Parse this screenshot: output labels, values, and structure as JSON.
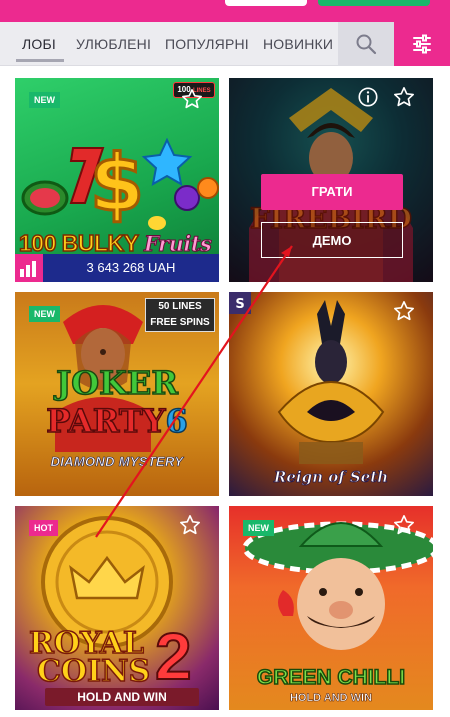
{
  "nav": {
    "tabs": [
      "ЛОБІ",
      "УЛЮБЛЕНІ",
      "ПОПУЛЯРНІ",
      "НОВИНКИ"
    ],
    "active_tab": "ЛОБІ",
    "search_icon": "search-icon",
    "filter_icon": "filter-sliders-icon"
  },
  "colors": {
    "accent": "#ec2a8f",
    "secondary_button": "#19b86a",
    "nav_bg": "#ececf0"
  },
  "games": [
    {
      "title": "100 BULKY Fruits",
      "logo_number": "100",
      "logo_word": "BULKY",
      "logo_script": "Fruits",
      "badge": "NEW",
      "corner_label_top": "100",
      "corner_label_bottom": "LINES",
      "jackpot": "3 643 268 UAH"
    },
    {
      "title": "Firebird Spirit",
      "play_label": "ГРАТИ",
      "demo_label": "ДЕМО",
      "info_icon": "info-icon"
    },
    {
      "title": "Joker Party 6",
      "logo_top": "JOKER",
      "logo_bottom": "PARTY",
      "logo_digit": "6",
      "logo_sub": "DIAMOND MYSTERY",
      "badge": "NEW",
      "lines_label": "50 LINES",
      "spins_label": "FREE SPINS"
    },
    {
      "title": "Reign of Seth",
      "provider_icon": "provider-s-icon"
    },
    {
      "title": "Royal Coins 2",
      "logo_top": "ROYAL",
      "logo_bottom": "COINS",
      "logo_digit": "2",
      "logo_sub": "HOLD AND WIN",
      "badge": "HOT"
    },
    {
      "title": "Green Chilli",
      "logo_top": "GREEN CHILLI",
      "logo_sub": "HOLD AND WIN",
      "badge": "NEW"
    }
  ]
}
